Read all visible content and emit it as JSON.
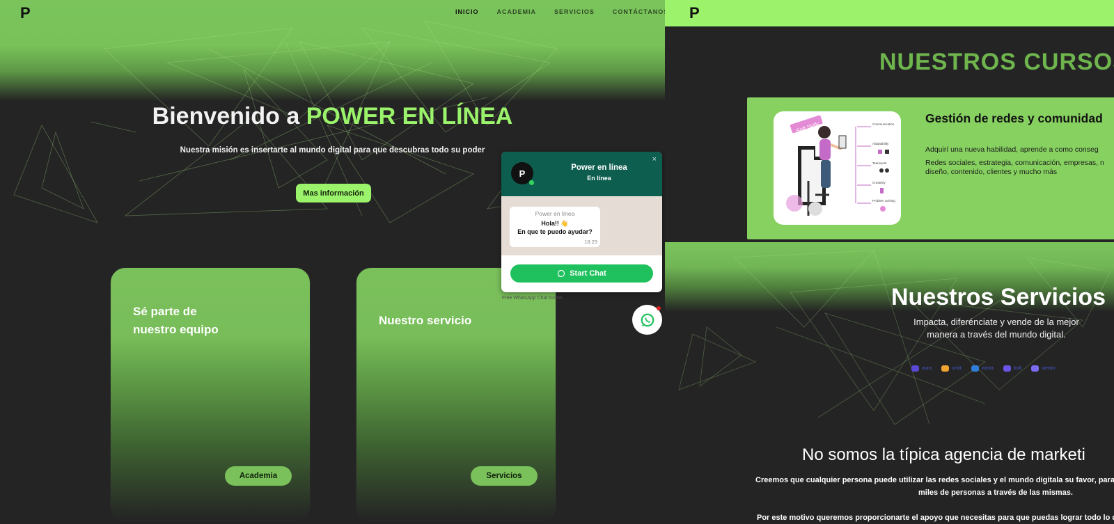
{
  "left": {
    "logo": "P",
    "nav": [
      {
        "label": "INICIO",
        "active": true
      },
      {
        "label": "ACADEMIA",
        "active": false
      },
      {
        "label": "SERVICIOS",
        "active": false
      },
      {
        "label": "CONTÁCTANOS",
        "active": false
      }
    ],
    "hero": {
      "title_prefix": "Bienvenido a ",
      "title_accent": "POWER EN LÍNEA",
      "subtitle": "Nuestra misión es insertarte al mundo digital para que descubras todo su poder",
      "cta": "Mas información"
    },
    "cards": [
      {
        "title": "Sé parte de nuestro equipo",
        "title_line1": "Sé parte de",
        "title_line2": "nuestro equipo",
        "button": "Academia"
      },
      {
        "title": "Nuestro servicio",
        "button": "Servicios"
      }
    ],
    "chat": {
      "avatar": "P",
      "name": "Power en línea",
      "status": "En línea",
      "close": "×",
      "bubble_sender": "Power en línea",
      "bubble_line1": "Hola!! 👋",
      "bubble_line2": "En que te puedo ayudar?",
      "bubble_time": "18:29",
      "start_button": "Start Chat",
      "footer": "Free WhatsApp Chat button"
    }
  },
  "right": {
    "logo": "P",
    "courses_title": "NUESTROS CURSOS",
    "course": {
      "title": "Gestión de redes y comunidad",
      "desc1": "Adquirí una nueva habilidad, aprende a como conseg",
      "desc2": "Redes sociales, estrategia, comunicación, empresas, n diseño, contenido, clientes y mucho más",
      "image_tag": "Soft Skills",
      "image_labels": [
        "Communication",
        "Adaptability",
        "Teamwork",
        "Creativity",
        "Problem Solving"
      ]
    },
    "services": {
      "title": "Nuestros Servicios",
      "subtitle": "Impacta, diferénciate y vende de la mejor manera a través del mundo digital.",
      "brands": [
        {
          "name": "aura",
          "icon": "aura-icon",
          "color": "#5a48d6"
        },
        {
          "name": "orbit",
          "icon": "orbit-icon",
          "color": "#f0a431"
        },
        {
          "name": "vanta",
          "icon": "vanta-icon",
          "color": "#2f7fd8"
        },
        {
          "name": "bolt",
          "icon": "bolt-icon",
          "color": "#6a55e6"
        },
        {
          "name": "viewio",
          "icon": "viewio-icon",
          "color": "#7b6bf0"
        }
      ]
    },
    "agency": {
      "title": "No somos la típica agencia de marketi",
      "p1_line1": "Creemos que cualquier persona puede utilizar las redes sociales y el mundo digitala su favor, para",
      "p1_line2": "miles de personas a través de las mismas.",
      "p2": "Por este motivo queremos proporcionarte el apoyo que necesitas para que puedas lograr todo lo q"
    }
  },
  "colors": {
    "accent": "#9af36a",
    "brand_green": "#7ac05b",
    "dark_bg": "#242424",
    "whatsapp_header": "#0d5e4f",
    "whatsapp_button": "#1ec15d"
  }
}
